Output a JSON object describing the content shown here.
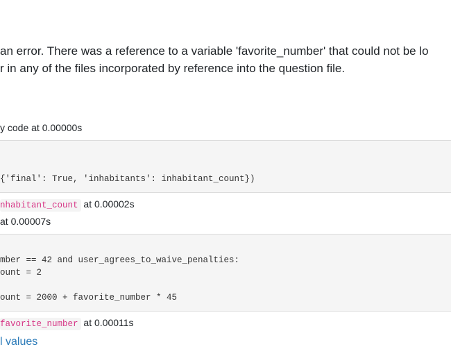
{
  "error_message": {
    "line1": "an error. There was a reference to a variable 'favorite_number' that could not be lo",
    "line2": "r in any of the files incorporated by reference into the question file."
  },
  "trace": {
    "line1": "y code at 0.00000s",
    "code_block_1": "{'final': True, 'inhabitants': inhabitant_count})",
    "line2_var": "nhabitant_count",
    "line2_suffix": " at 0.00002s",
    "line3": "at 0.00007s",
    "code_block_2": "mber == 42 and user_agrees_to_waive_penalties:\nount = 2\n\nount = 2000 + favorite_number * 45",
    "line4_var": "favorite_number",
    "line4_suffix": " at 0.00011s"
  },
  "links": {
    "values_link": "l values"
  }
}
